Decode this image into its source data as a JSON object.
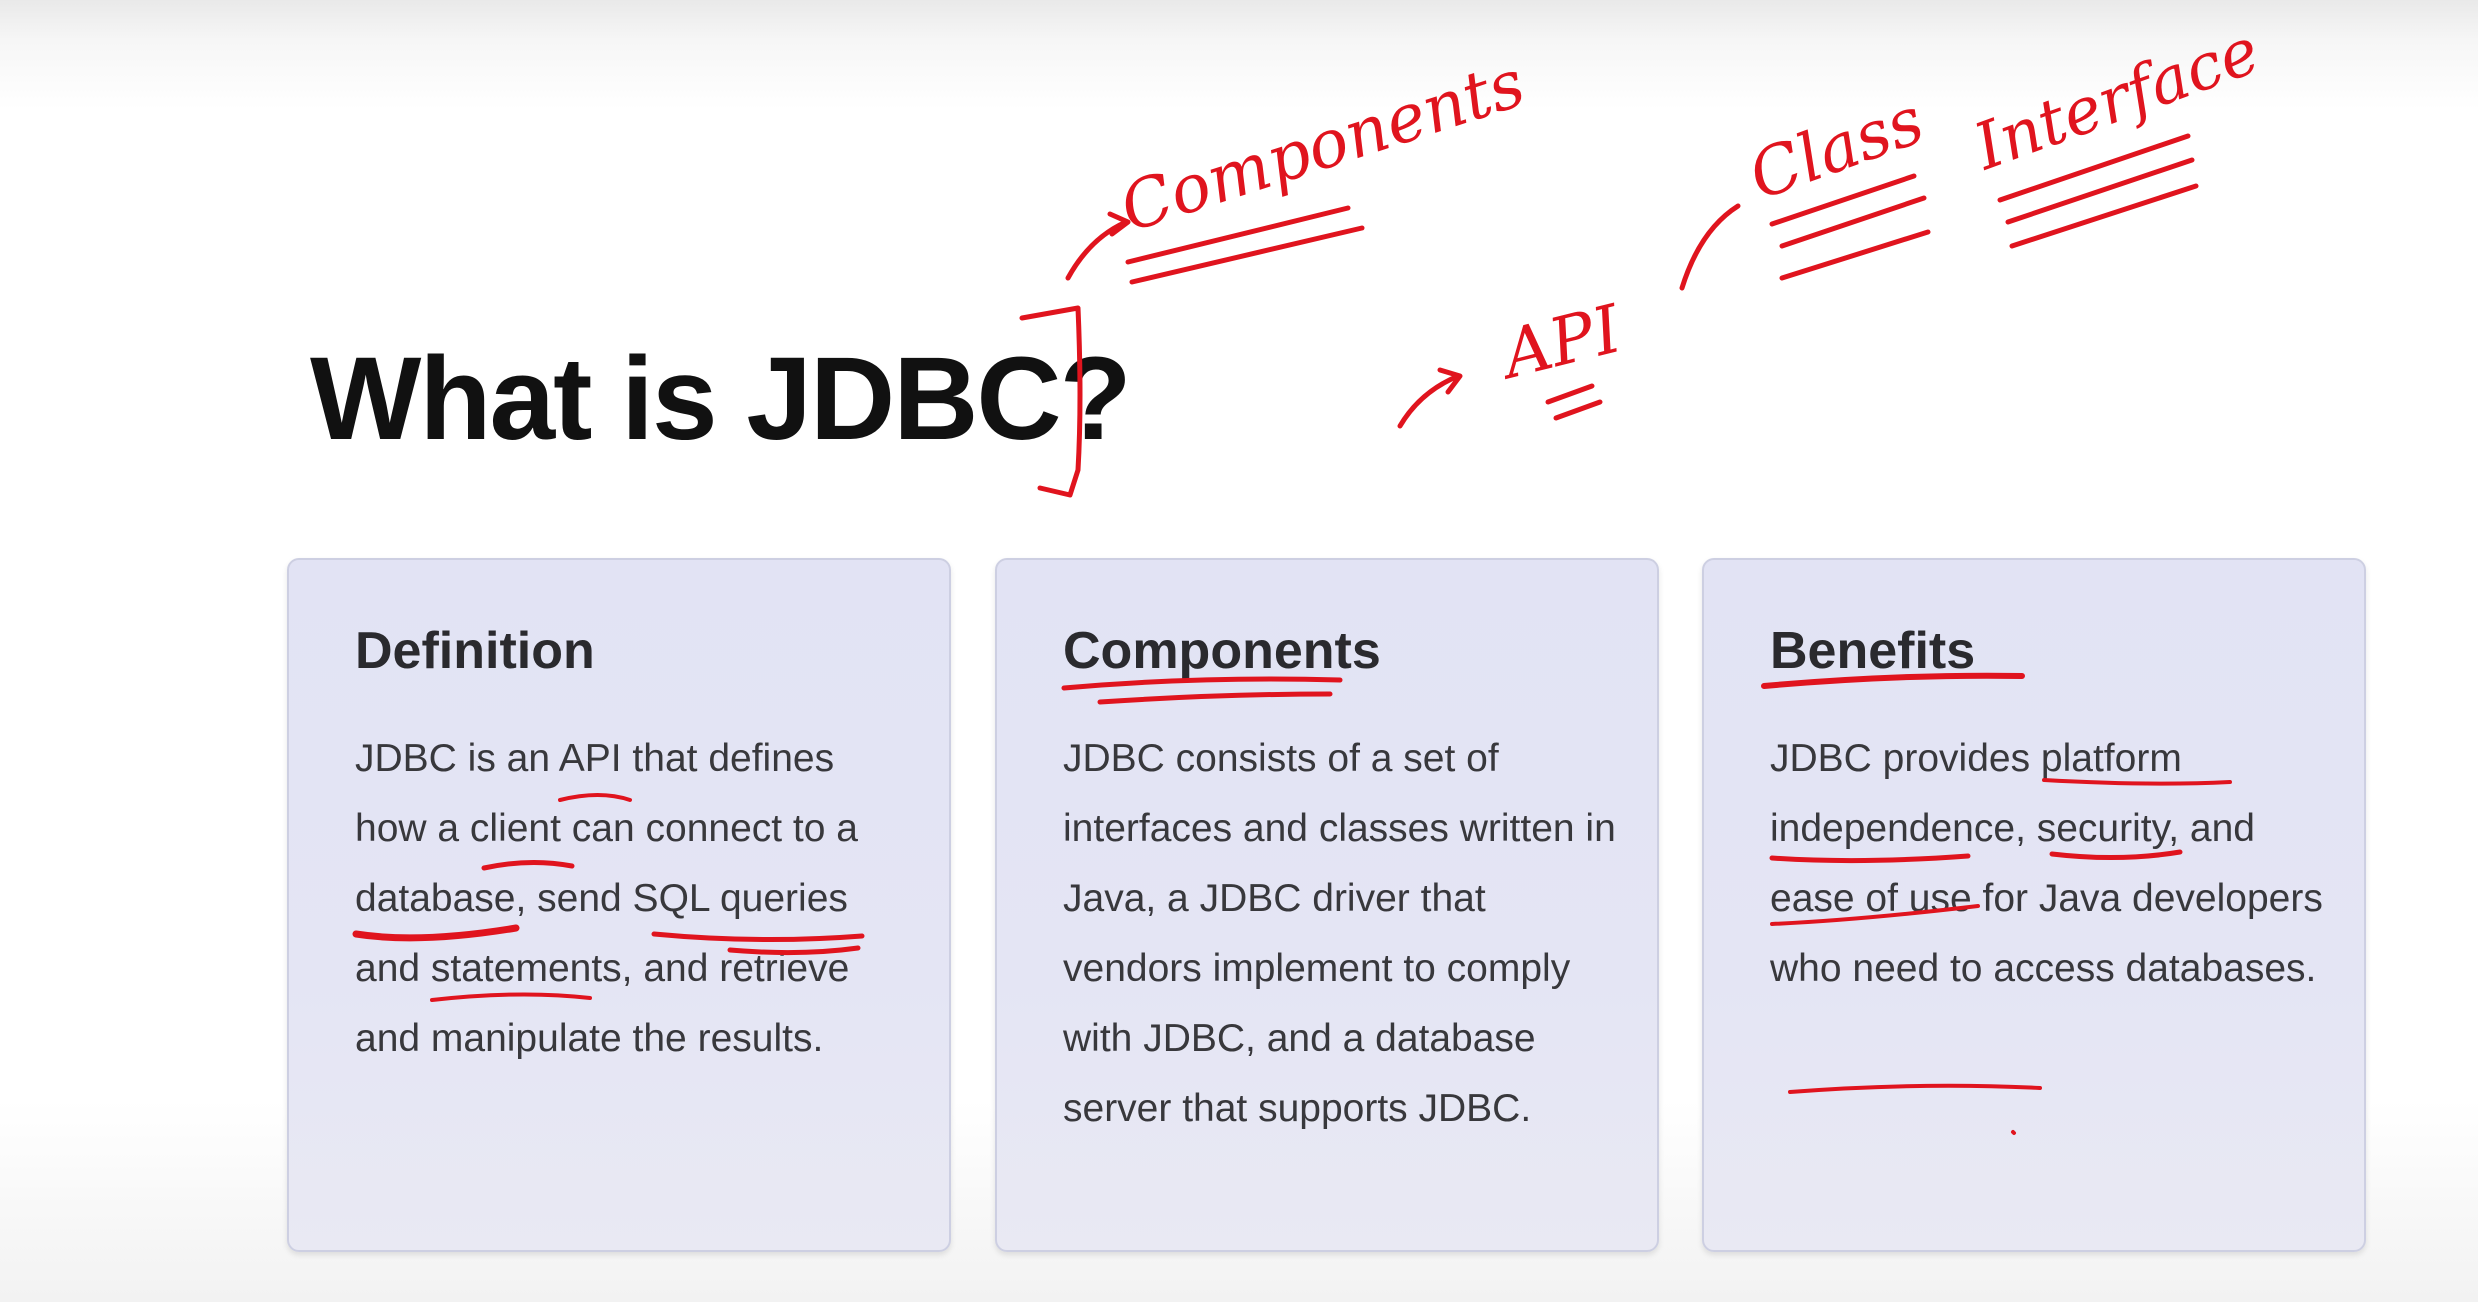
{
  "slide": {
    "title": "What is JDBC?"
  },
  "cards": [
    {
      "heading": "Definition",
      "body": "JDBC is an API that defines how a client can connect to a database, send SQL queries and statements, and retrieve and manipulate the results."
    },
    {
      "heading": "Components",
      "body": "JDBC consists of a set of interfaces and classes written in Java, a JDBC driver that vendors implement to comply with JDBC, and a database server that supports JDBC."
    },
    {
      "heading": "Benefits",
      "body": "JDBC provides platform independence, security, and ease of use for Java developers who need to access databases."
    }
  ],
  "handwritten_notes": {
    "note_components": "Components",
    "note_api": "API",
    "note_class": "Class",
    "note_interface": "Interface"
  },
  "colors": {
    "ink": "#e0141e",
    "card_background": "#e3e4f4",
    "title_text": "#111111"
  }
}
